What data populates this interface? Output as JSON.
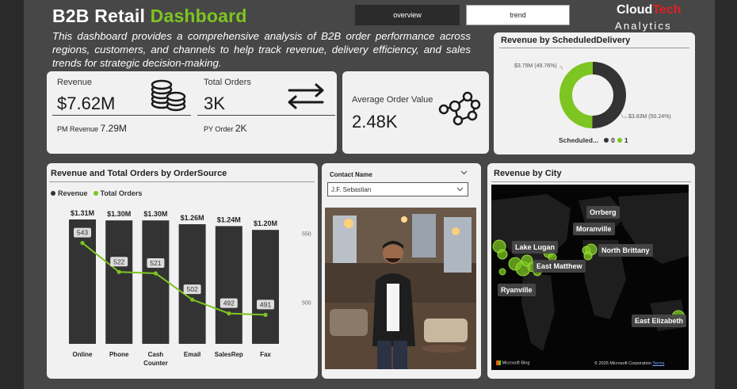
{
  "header": {
    "title_main": "B2B Retail",
    "title_accent": "Dashboard",
    "description": "This dashboard provides a comprehensive analysis of B2B order performance across regions, customers, and channels to help track revenue, delivery efficiency, and sales trends for strategic decision-making."
  },
  "nav": {
    "overview_label": "overview",
    "trend_label": "trend"
  },
  "brand": {
    "name_white": "Cloud",
    "name_red": "Tech",
    "subtitle": "Analytics"
  },
  "kpis": {
    "revenue_label": "Revenue",
    "revenue_value": "$7.62M",
    "pm_revenue_label": "PM Revenue",
    "pm_revenue_value": "7.29M",
    "orders_label": "Total Orders",
    "orders_value": "3K",
    "py_orders_label": "PY Order",
    "py_orders_value": "2K",
    "aov_label": "Average Order Value",
    "aov_value": "2.48K"
  },
  "icons": {
    "revenue": "coins-stack-icon",
    "orders": "exchange-arrows-icon",
    "aov": "network-nodes-icon"
  },
  "donut": {
    "title": "Revenue by ScheduledDelivery",
    "label_green": "$3.79M (49.76%)",
    "label_dark": "$3.83M (50.24%)",
    "legend_title": "Scheduled...",
    "legend_0": "0",
    "legend_1": "1"
  },
  "bar_chart_title": "Revenue and Total Orders by OrderSource",
  "bar_legend": {
    "revenue": "Revenue",
    "orders": "Total Orders"
  },
  "contact": {
    "label": "Contact Name",
    "selected": "J.F. Sebastian"
  },
  "map": {
    "title": "Revenue by City",
    "cities": [
      "Orrberg",
      "Moranville",
      "Lake Lugan",
      "North Brittany",
      "East Matthew",
      "Ryanville",
      "East Elizabeth"
    ],
    "footer_left": "Microsoft Bing",
    "footer_right": "© 2025 Microsoft Corporation",
    "terms": "Terms"
  },
  "colors": {
    "green": "#7dc521",
    "dark": "#333333",
    "bg": "#474747",
    "card": "#f1f1f1",
    "brand_red": "#e02020"
  },
  "chart_data": [
    {
      "type": "bar",
      "title": "Revenue and Total Orders by OrderSource",
      "categories": [
        "Online",
        "Phone",
        "Cash Counter",
        "Email",
        "SalesRep",
        "Fax"
      ],
      "series": [
        {
          "name": "Revenue",
          "type": "bar",
          "values": [
            1.31,
            1.3,
            1.3,
            1.26,
            1.24,
            1.2
          ],
          "labels": [
            "$1.31M",
            "$1.30M",
            "$1.30M",
            "$1.26M",
            "$1.24M",
            "$1.20M"
          ],
          "color": "#333333"
        },
        {
          "name": "Total Orders",
          "type": "line",
          "values": [
            543,
            522,
            521,
            502,
            492,
            491
          ],
          "color": "#7dc521"
        }
      ],
      "y2_ticks": [
        "550",
        "500"
      ],
      "y2lim": [
        470,
        560
      ]
    },
    {
      "type": "pie",
      "title": "Revenue by ScheduledDelivery",
      "categories": [
        "1",
        "0"
      ],
      "values": [
        3.79,
        3.83
      ],
      "percent": [
        49.76,
        50.24
      ]
    }
  ]
}
